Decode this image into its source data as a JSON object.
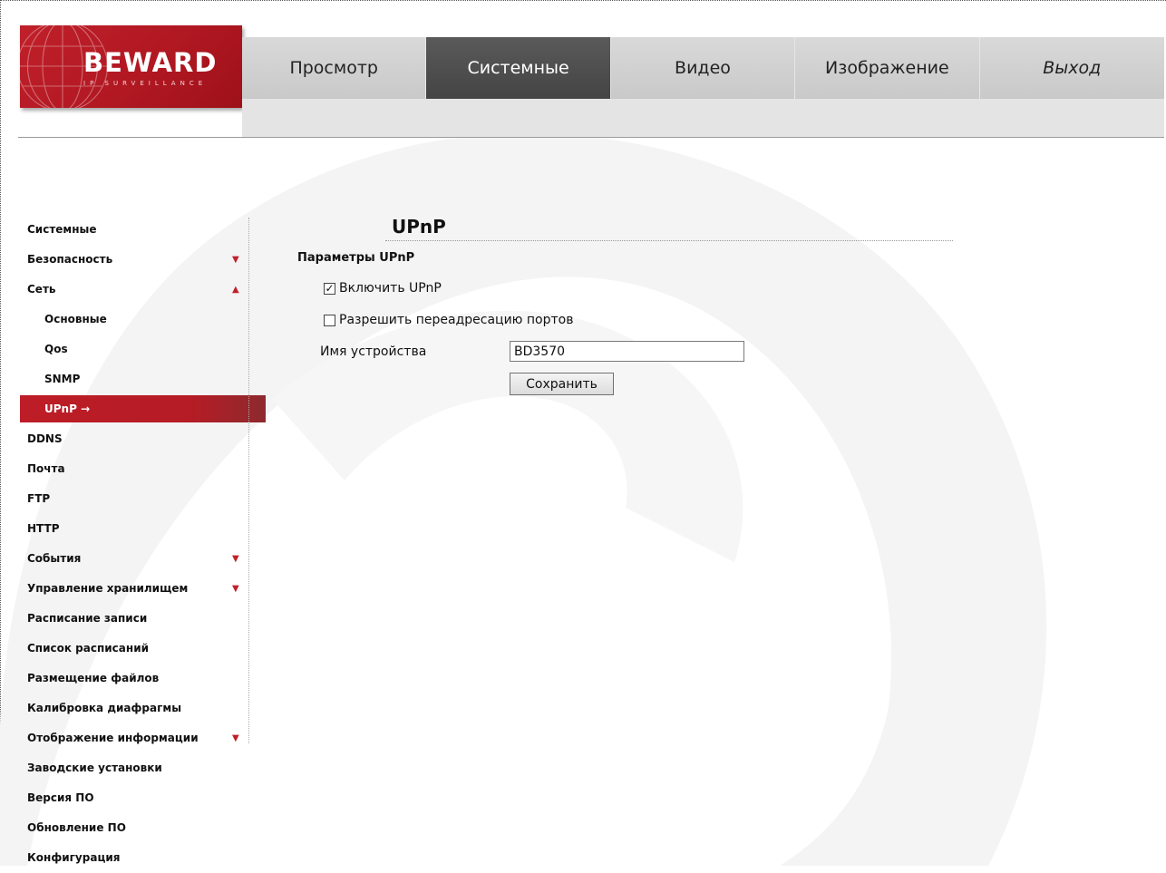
{
  "logo": {
    "brand": "BEWARD",
    "tagline": "IP SURVEILLANCE"
  },
  "nav": [
    {
      "label": "Просмотр",
      "active": false
    },
    {
      "label": "Системные",
      "active": true
    },
    {
      "label": "Видео",
      "active": false
    },
    {
      "label": "Изображение",
      "active": false
    },
    {
      "label": "Выход",
      "active": false
    }
  ],
  "sidebar": {
    "items": [
      {
        "label": "Системные"
      },
      {
        "label": "Безопасность",
        "arrow": "▼"
      },
      {
        "label": "Сеть",
        "arrow": "▲"
      },
      {
        "label": "Основные",
        "sub": true
      },
      {
        "label": "Qos",
        "sub": true
      },
      {
        "label": "SNMP",
        "sub": true
      },
      {
        "label": "UPnP",
        "sub": true,
        "active": true,
        "marker": "→"
      },
      {
        "label": "DDNS"
      },
      {
        "label": "Почта"
      },
      {
        "label": "FTP"
      },
      {
        "label": "HTTP"
      },
      {
        "label": "События",
        "arrow": "▼"
      },
      {
        "label": "Управление хранилищем",
        "arrow": "▼"
      },
      {
        "label": "Расписание записи"
      },
      {
        "label": "Список расписаний"
      },
      {
        "label": "Размещение файлов"
      },
      {
        "label": "Калибровка диафрагмы"
      },
      {
        "label": "Отображение информации",
        "arrow": "▼"
      },
      {
        "label": "Заводские установки"
      },
      {
        "label": "Версия ПО"
      },
      {
        "label": "Обновление ПО"
      },
      {
        "label": "Конфигурация"
      }
    ]
  },
  "content": {
    "title": "UPnP",
    "section_title": "Параметры UPnP",
    "enable_upnp": {
      "label": "Включить UPnP",
      "checked": true
    },
    "port_forwarding": {
      "label": "Разрешить переадресацию портов",
      "checked": false
    },
    "device_name_label": "Имя устройства",
    "device_name_value": "BD3570",
    "save_label": "Сохранить"
  },
  "colors": {
    "brand_red": "#c0202a",
    "nav_active": "#4a4a4a",
    "nav_bg": "#d0d0d0"
  }
}
